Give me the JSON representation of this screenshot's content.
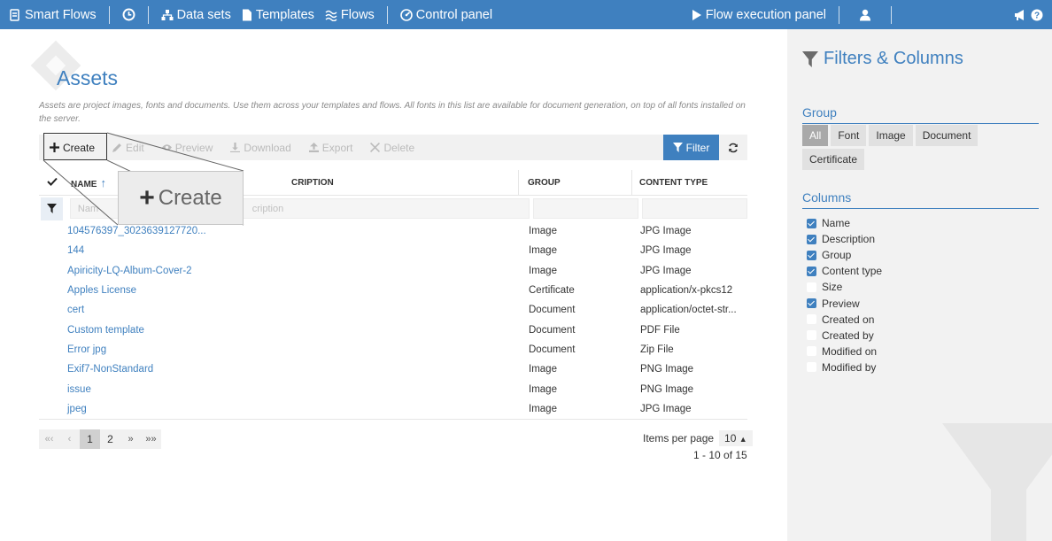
{
  "nav": {
    "brand": "Smart Flows",
    "datasets": "Data sets",
    "templates": "Templates",
    "flows": "Flows",
    "control_panel": "Control panel",
    "flow_execution": "Flow execution panel"
  },
  "page": {
    "title": "Assets",
    "description": "Assets are project images, fonts and documents. Use them across your templates and flows. All fonts in this list are available for document generation, on top of all fonts installed on the server."
  },
  "toolbar": {
    "create": "Create",
    "edit": "Edit",
    "preview": "Preview",
    "download": "Download",
    "export": "Export",
    "delete": "Delete",
    "filter": "Filter"
  },
  "zoom": {
    "label": "Create"
  },
  "table": {
    "headers": {
      "name": "NAME",
      "description": "CRIPTION",
      "group": "GROUP",
      "content_type": "CONTENT TYPE"
    },
    "filter_placeholders": {
      "name": "Nam",
      "description": "cription"
    },
    "rows": [
      {
        "name": "104576397_3023639127720...",
        "group": "Image",
        "content_type": "JPG Image"
      },
      {
        "name": "144",
        "group": "Image",
        "content_type": "JPG Image"
      },
      {
        "name": "Apiricity-LQ-Album-Cover-2",
        "group": "Image",
        "content_type": "JPG Image"
      },
      {
        "name": "Apples License",
        "group": "Certificate",
        "content_type": "application/x-pkcs12"
      },
      {
        "name": "cert",
        "group": "Document",
        "content_type": "application/octet-str..."
      },
      {
        "name": "Custom template",
        "group": "Document",
        "content_type": "PDF File"
      },
      {
        "name": "Error jpg",
        "group": "Document",
        "content_type": "Zip File"
      },
      {
        "name": "Exif7-NonStandard",
        "group": "Image",
        "content_type": "PNG Image"
      },
      {
        "name": "issue",
        "group": "Image",
        "content_type": "PNG Image"
      },
      {
        "name": "jpeg",
        "group": "Image",
        "content_type": "JPG Image"
      }
    ]
  },
  "pagination": {
    "first": "«‹",
    "prev": "‹",
    "pages": [
      "1",
      "2"
    ],
    "next": "»",
    "last": "»»",
    "items_per_page_label": "Items per page",
    "items_per_page_value": "10",
    "range": "1 - 10 of 15"
  },
  "side": {
    "title": "Filters & Columns",
    "group_title": "Group",
    "groups": [
      "All",
      "Font",
      "Image",
      "Document",
      "Certificate"
    ],
    "columns_title": "Columns",
    "columns": [
      {
        "label": "Name",
        "checked": true
      },
      {
        "label": "Description",
        "checked": true
      },
      {
        "label": "Group",
        "checked": true
      },
      {
        "label": "Content type",
        "checked": true
      },
      {
        "label": "Size",
        "checked": false
      },
      {
        "label": "Preview",
        "checked": true
      },
      {
        "label": "Created on",
        "checked": false
      },
      {
        "label": "Created by",
        "checked": false
      },
      {
        "label": "Modified on",
        "checked": false
      },
      {
        "label": "Modified by",
        "checked": false
      }
    ]
  },
  "colors": {
    "accent": "#3f80bf",
    "panel_bg": "#f2f2f2",
    "toolbar_bg": "#f1f1f1"
  }
}
